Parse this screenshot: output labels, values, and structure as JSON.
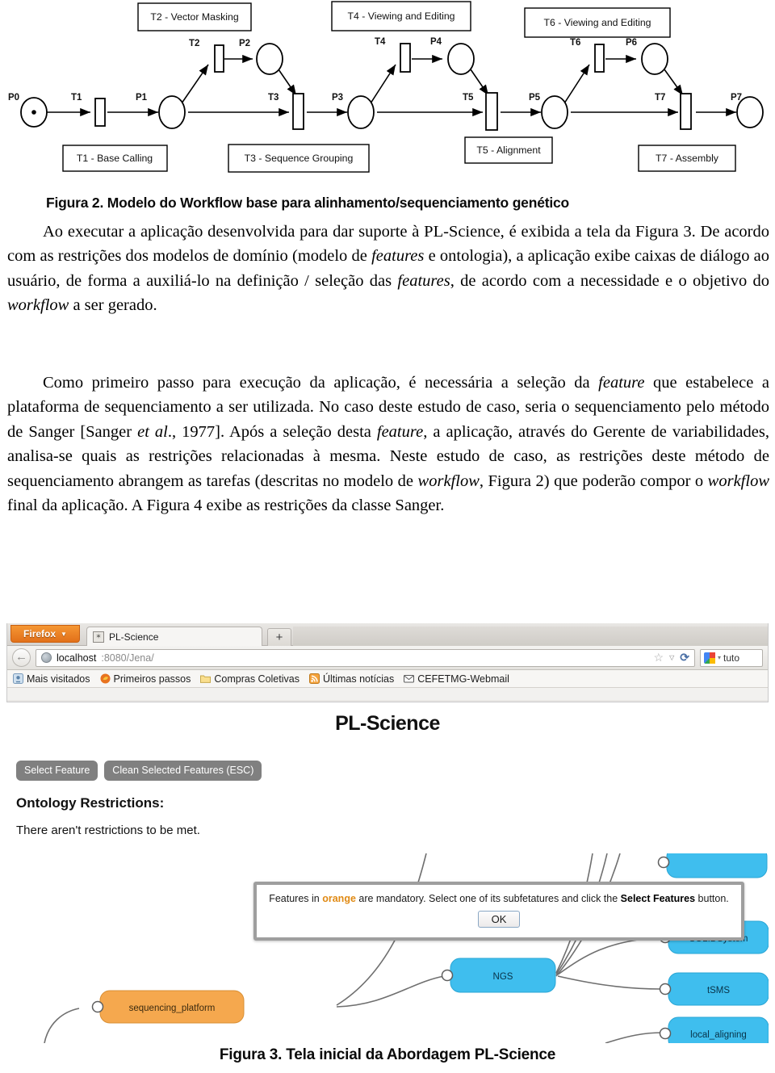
{
  "figure2": {
    "caption": "Figura 2. Modelo do Workflow base para alinhamento/sequenciamento genético",
    "places": [
      {
        "id": "P0",
        "label": "P0",
        "has_token": true
      },
      {
        "id": "P1",
        "label": "P1",
        "has_token": false
      },
      {
        "id": "P2",
        "label": "P2",
        "has_token": false
      },
      {
        "id": "P3",
        "label": "P3",
        "has_token": false
      },
      {
        "id": "P4",
        "label": "P4",
        "has_token": false
      },
      {
        "id": "P5",
        "label": "P5",
        "has_token": false
      },
      {
        "id": "P6",
        "label": "P6",
        "has_token": false
      },
      {
        "id": "P7",
        "label": "P7",
        "has_token": false
      }
    ],
    "transitions": [
      {
        "id": "T1",
        "label": "T1"
      },
      {
        "id": "T2",
        "label": "T2"
      },
      {
        "id": "T3",
        "label": "T3"
      },
      {
        "id": "T4",
        "label": "T4"
      },
      {
        "id": "T5",
        "label": "T5"
      },
      {
        "id": "T6",
        "label": "T6"
      },
      {
        "id": "T7",
        "label": "T7"
      }
    ],
    "legend_boxes": [
      {
        "id": "T1",
        "text": "T1 - Base Calling",
        "position": "below"
      },
      {
        "id": "T2",
        "text": "T2 - Vector Masking",
        "position": "above"
      },
      {
        "id": "T3",
        "text": "T3 - Sequence Grouping",
        "position": "below"
      },
      {
        "id": "T4",
        "text": "T4 - Viewing and Editing",
        "position": "above"
      },
      {
        "id": "T5",
        "text": "T5 - Alignment",
        "position": "below"
      },
      {
        "id": "T6",
        "text": "T6 - Viewing and Editing",
        "position": "above"
      },
      {
        "id": "T7",
        "text": "T7 - Assembly",
        "position": "below"
      }
    ]
  },
  "paragraphs": {
    "p1": {
      "seg1": "Ao executar a aplicação desenvolvida para dar suporte à PL-Science, é exibida a tela da Figura 3. De acordo com as restrições dos modelos de domínio (modelo de ",
      "it1": "features",
      "seg2": " e ontologia), a aplicação exibe caixas de diálogo ao usuário, de forma a auxiliá-lo na definição / seleção das ",
      "it2": "features",
      "seg3": ", de acordo com a necessidade e o objetivo do ",
      "it3": "workflow",
      "seg4": " a ser gerado."
    },
    "p2": {
      "seg1": "Como primeiro passo para execução da aplicação, é necessária a seleção da ",
      "it1": "feature",
      "seg2": " que estabelece a plataforma de sequenciamento a ser utilizada. No caso deste estudo de caso, seria o sequenciamento pelo método de Sanger [Sanger ",
      "it2": "et al",
      "seg3": "., 1977]. Após a seleção desta ",
      "it3": "feature",
      "seg4": ", a aplicação, através do Gerente de variabilidades, analisa-se quais as restrições relacionadas à mesma. Neste estudo de caso, as restrições deste método de sequenciamento abrangem as tarefas (descritas no modelo de ",
      "it4": "workflow",
      "seg5": ", Figura 2) que poderão compor o ",
      "it5": "workflow",
      "seg6": " final da aplicação. A Figura 4 exibe as restrições da classe Sanger."
    }
  },
  "browser": {
    "app_button": "Firefox",
    "tab_title": "PL-Science",
    "new_tab_label": "+",
    "url_host": "localhost",
    "url_rest": ":8080/Jena/",
    "search_value": "tuto",
    "bookmarks": [
      {
        "label": "Mais visitados",
        "icon": "most-visited-icon"
      },
      {
        "label": "Primeiros passos",
        "icon": "firefox-icon"
      },
      {
        "label": "Compras Coletivas",
        "icon": "folder-icon"
      },
      {
        "label": "Últimas notícias",
        "icon": "rss-icon"
      },
      {
        "label": "CEFETMG-Webmail",
        "icon": "mail-icon"
      }
    ]
  },
  "app": {
    "title": "PL-Science",
    "buttons": [
      {
        "label": "Select Feature",
        "name": "select-feature-button"
      },
      {
        "label": "Clean Selected Features (ESC)",
        "name": "clean-selected-features-button"
      }
    ],
    "restrictions_heading": "Ontology Restrictions:",
    "restrictions_text": "There aren't restrictions to be met."
  },
  "dialog": {
    "msg_part1": "Features in ",
    "msg_orange": "orange",
    "msg_part2": " are mandatory. Select one of its subfetatures and click the ",
    "msg_bold": "Select Features",
    "msg_part3": " button.",
    "ok_label": "OK"
  },
  "feature_model": {
    "nodes": [
      {
        "id": "sequencing_platform",
        "label": "sequencing_platform",
        "color": "#F5A84E",
        "type": "mandatory"
      },
      {
        "id": "ngs",
        "label": "NGS",
        "color": "#3FBEEE",
        "type": "optional"
      },
      {
        "id": "solidsystem",
        "label": "SOLIDSystem",
        "color": "#3FBEEE",
        "type": "optional"
      },
      {
        "id": "tsms",
        "label": "tSMS",
        "color": "#3FBEEE",
        "type": "optional"
      },
      {
        "id": "local_aligning",
        "label": "local_aligning",
        "color": "#3FBEEE",
        "type": "optional"
      },
      {
        "id": "hidden_top",
        "label": "",
        "color": "#3FBEEE",
        "type": "optional"
      }
    ],
    "colors": {
      "mandatory": "#F5A84E",
      "optional": "#3FBEEE",
      "edge": "#6f6f6f"
    }
  },
  "figure3": {
    "caption": "Figura 3. Tela inicial da Abordagem PL-Science"
  }
}
